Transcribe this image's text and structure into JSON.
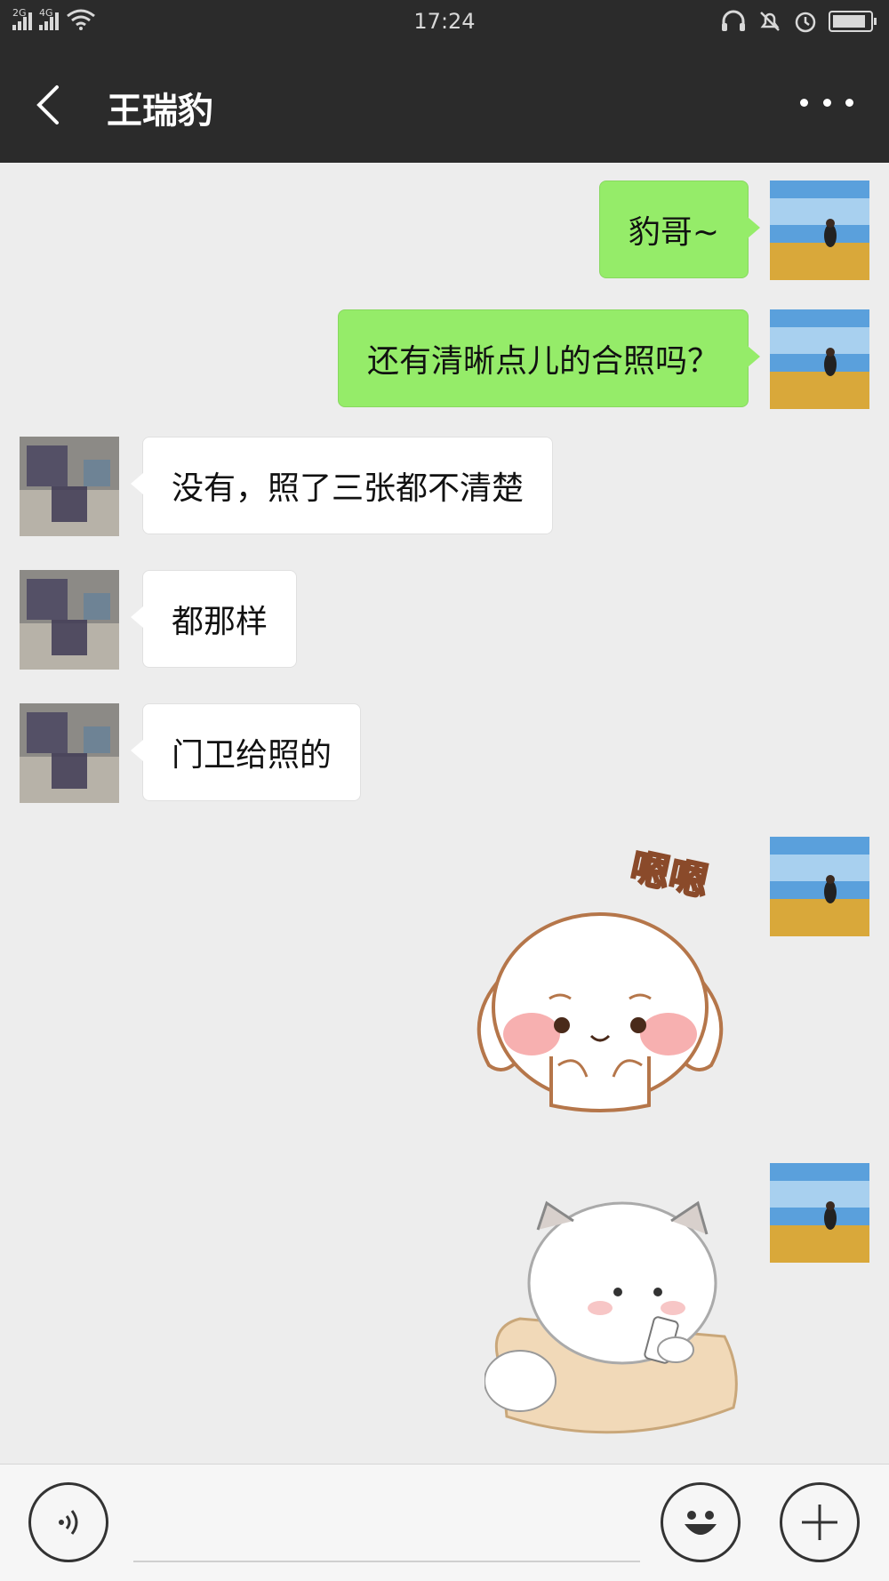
{
  "status_bar": {
    "time": "17:24",
    "network_1": "2G",
    "network_2": "4G",
    "battery_level": 0.9,
    "icons": [
      "signal-icon",
      "wifi-icon",
      "headset-icon",
      "bell-muted-icon",
      "alarm-icon",
      "battery-icon"
    ]
  },
  "nav": {
    "title": "王瑞豹",
    "back_icon": "chevron-left-icon",
    "more_icon": "more-icon"
  },
  "messages": [
    {
      "side": "out",
      "type": "text",
      "text": "豹哥~"
    },
    {
      "side": "out",
      "type": "text",
      "text": "还有清晰点儿的合照吗？"
    },
    {
      "side": "in",
      "type": "text",
      "text": "没有，照了三张都不清楚"
    },
    {
      "side": "in",
      "type": "text",
      "text": "都那样"
    },
    {
      "side": "in",
      "type": "text",
      "text": "门卫给照的"
    },
    {
      "side": "out",
      "type": "sticker",
      "text": "嗯嗯"
    },
    {
      "side": "out",
      "type": "sticker",
      "text": ""
    }
  ],
  "input_bar": {
    "voice_icon": "voice-icon",
    "emoji_icon": "emoji-icon",
    "plus_icon": "plus-icon"
  },
  "colors": {
    "header_bg": "#2b2b2b",
    "chat_bg": "#ededed",
    "out_bubble": "#95ec69",
    "in_bubble": "#ffffff"
  }
}
